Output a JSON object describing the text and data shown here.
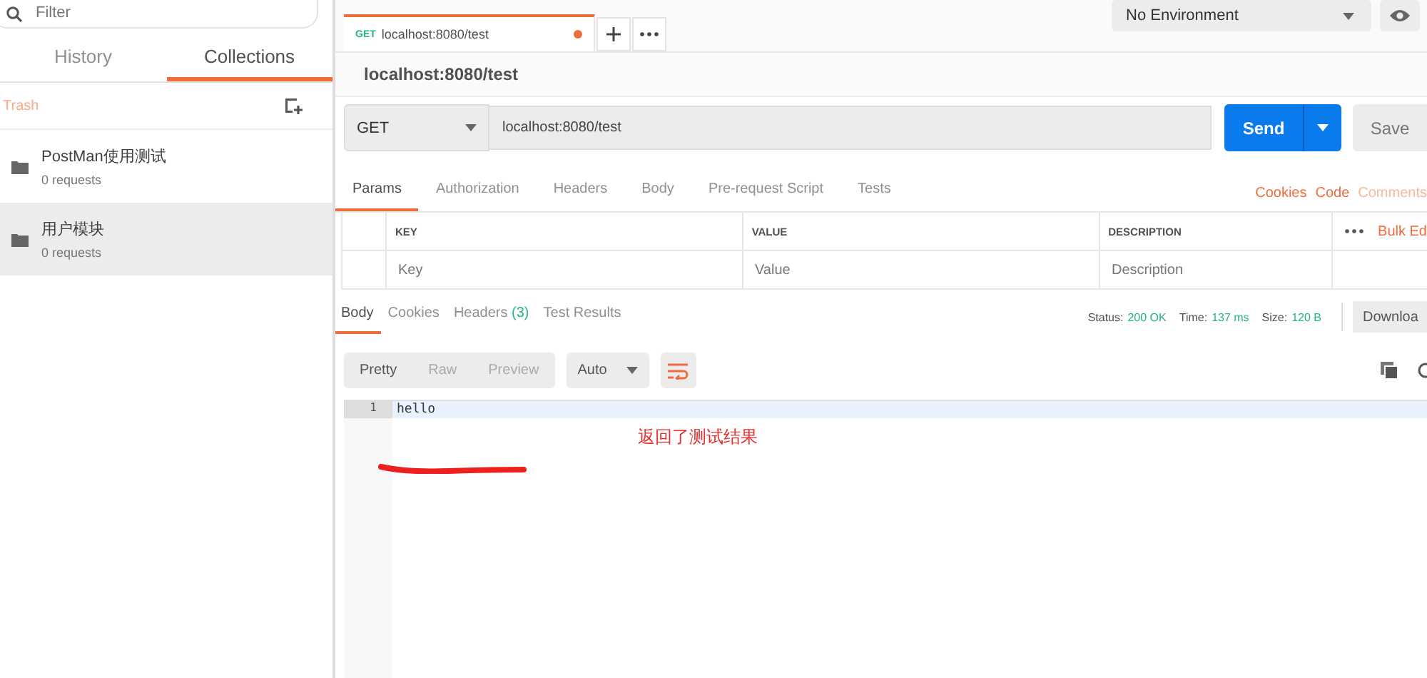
{
  "sidebar": {
    "filter": {
      "placeholder": "Filter"
    },
    "tabs": [
      {
        "label": "History",
        "selected": false
      },
      {
        "label": "Collections",
        "selected": true
      }
    ],
    "trash": "Trash",
    "collections": [
      {
        "name": "PostMan使用测试",
        "count": "0 requests",
        "selected": false
      },
      {
        "name": "用户模块",
        "count": "0 requests",
        "selected": true
      }
    ]
  },
  "request_tabs": [
    {
      "method": "GET",
      "title": "localhost:8080/test",
      "unsaved": true,
      "selected": true
    }
  ],
  "environment": "No Environment",
  "request": {
    "title": "localhost:8080/test",
    "method": "GET",
    "url": "localhost:8080/test",
    "send": "Send",
    "save": "Save"
  },
  "request_sections": [
    {
      "label": "Params",
      "selected": true
    },
    {
      "label": "Authorization",
      "selected": false
    },
    {
      "label": "Headers",
      "selected": false
    },
    {
      "label": "Body",
      "selected": false
    },
    {
      "label": "Pre-request Script",
      "selected": false
    },
    {
      "label": "Tests",
      "selected": false
    }
  ],
  "request_links": [
    {
      "label": "Cookies",
      "disabled": false
    },
    {
      "label": "Code",
      "disabled": false
    },
    {
      "label": "Comments",
      "disabled": true
    }
  ],
  "params": {
    "columns": [
      "KEY",
      "VALUE",
      "DESCRIPTION"
    ],
    "bulk_edit": "Bulk Ed",
    "placeholders": [
      "Key",
      "Value",
      "Description"
    ]
  },
  "response_tabs": [
    {
      "label": "Body",
      "selected": true
    },
    {
      "label": "Cookies",
      "selected": false
    },
    {
      "label": "Headers",
      "count": "(3)",
      "selected": false
    },
    {
      "label": "Test Results",
      "selected": false
    }
  ],
  "status": [
    {
      "label": "Status:",
      "value": "200 OK"
    },
    {
      "label": "Time:",
      "value": "137 ms"
    },
    {
      "label": "Size:",
      "value": "120 B"
    }
  ],
  "download": "Downloa",
  "view_modes": [
    {
      "label": "Pretty",
      "selected": true
    },
    {
      "label": "Raw",
      "selected": false
    },
    {
      "label": "Preview",
      "selected": false
    }
  ],
  "format": "Auto",
  "body_lines": [
    {
      "number": "1",
      "text": "hello"
    }
  ],
  "annotation": "返回了测试结果"
}
